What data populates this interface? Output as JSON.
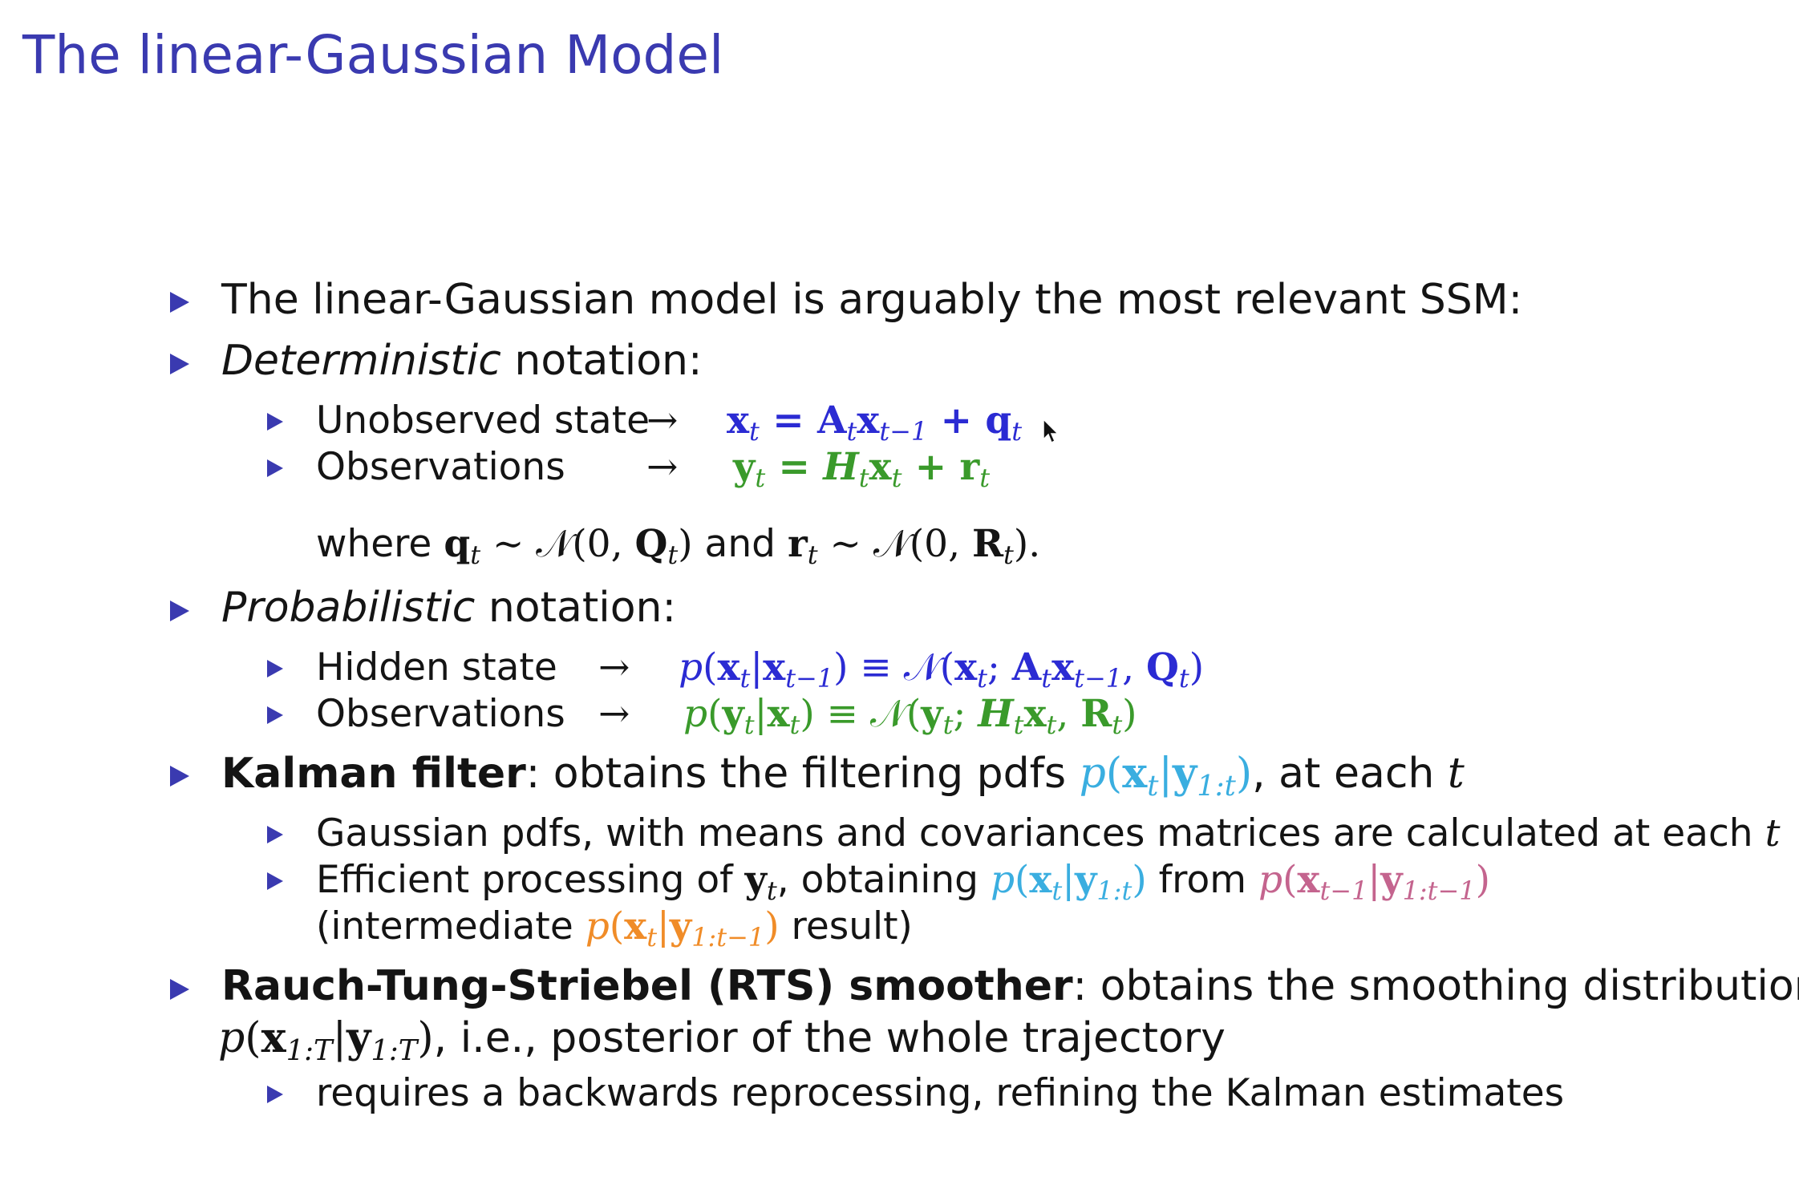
{
  "slide": {
    "title": "The linear-Gaussian Model",
    "bullet1": "The linear-Gaussian model is arguably the most relevant SSM:",
    "det_label": "Deterministic",
    "det_suffix": "notation:",
    "unobs_label": "Unobserved state",
    "obs_label": "Observations",
    "arrow": "→",
    "eq_state": {
      "x": "x",
      "t": "t",
      "eq": " = ",
      "A": "A",
      "tm1": "t−1",
      "plus": " + ",
      "q": "q"
    },
    "eq_obs": {
      "y": "y",
      "t": "t",
      "eq": " = ",
      "H": "H",
      "x": "x",
      "plus": " + ",
      "r": "r"
    },
    "where": "where",
    "and": "and",
    "noise_q": "q",
    "noise_r": "r",
    "sim": " ∼ ",
    "N": "𝒩",
    "N_q_args": "(0, ",
    "Q": "Q",
    "R": "R",
    "close": ")",
    "close_dot": ").",
    "prob_label": "Probabilistic",
    "prob_suffix": "notation:",
    "hidden_label": "Hidden state",
    "obs2_label": "Observations",
    "prob_state": {
      "p_open": "p(",
      "x": "x",
      "bar": "|",
      "equiv": ") ≡ ",
      "N_open": "(",
      "semi": "; ",
      "comma": ", "
    },
    "kalman_label": "Kalman filter",
    "kalman_text": ": obtains the filtering pdfs",
    "kalman_tail": ", at each",
    "t": "t",
    "gauss_text": "Gaussian pdfs, with means and covariances matrices are calculated at each",
    "eff_text": "Efficient processing of",
    "eff_obtaining": ", obtaining",
    "eff_from": "from",
    "inter_open": "(intermediate",
    "inter_close": "result)",
    "rts_label": "Rauch-Tung-Striebel (RTS) smoother",
    "rts_text": ": obtains the smoothing distribution",
    "rts_line2": ", i.e., posterior of the whole trajectory",
    "rts_sub": "requires a backwards reprocessing, refining the Kalman estimates",
    "idx_1t": "1:t",
    "idx_1tm1": "1:t−1",
    "idx_1T": "1:T",
    "idx_T": "T",
    "colors": {
      "title": "#3a3ab0",
      "blue": "#2b2bd3",
      "green": "#3a9a2b",
      "cyan": "#3aaee0",
      "pink": "#c4648e",
      "orange": "#f08c28"
    }
  }
}
